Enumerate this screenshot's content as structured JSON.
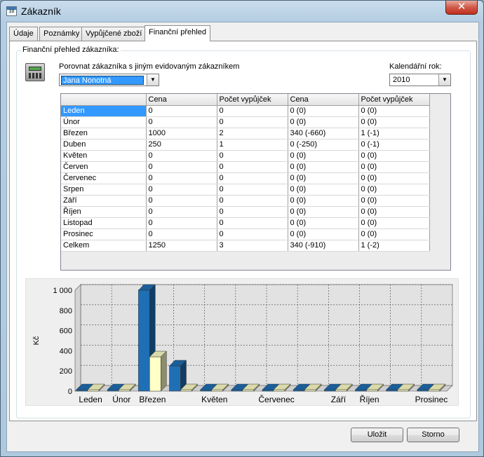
{
  "window": {
    "title": "Zákazník",
    "close_glyph": "✕"
  },
  "tabs": [
    {
      "label": "Údaje",
      "active": false
    },
    {
      "label": "Poznámky",
      "active": false
    },
    {
      "label": "Vypůjčené zboží",
      "active": false
    },
    {
      "label": "Finanční přehled",
      "active": true
    }
  ],
  "panel": {
    "group_title": "Finanční přehled zákazníka:",
    "compare_label": "Porovnat zákazníka s jiným evidovaným zákazníkem",
    "compare_value": "Jana Nonotná",
    "year_label": "Kalendářní rok:",
    "year_value": "2010",
    "icon": "calculator-icon"
  },
  "table": {
    "columns": [
      "",
      "Cena",
      "Počet vypůjček",
      "Cena",
      "Počet vypůjček"
    ],
    "rows": [
      [
        "Leden",
        "0",
        "0",
        "0  (0)",
        "0  (0)"
      ],
      [
        "Únor",
        "0",
        "0",
        "0  (0)",
        "0  (0)"
      ],
      [
        "Březen",
        "1000",
        "2",
        "340  (-660)",
        "1  (-1)"
      ],
      [
        "Duben",
        "250",
        "1",
        "0  (-250)",
        "0  (-1)"
      ],
      [
        "Květen",
        "0",
        "0",
        "0  (0)",
        "0  (0)"
      ],
      [
        "Červen",
        "0",
        "0",
        "0  (0)",
        "0  (0)"
      ],
      [
        "Červenec",
        "0",
        "0",
        "0  (0)",
        "0  (0)"
      ],
      [
        "Srpen",
        "0",
        "0",
        "0  (0)",
        "0  (0)"
      ],
      [
        "Září",
        "0",
        "0",
        "0  (0)",
        "0  (0)"
      ],
      [
        "Říjen",
        "0",
        "0",
        "0  (0)",
        "0  (0)"
      ],
      [
        "Listopad",
        "0",
        "0",
        "0  (0)",
        "0  (0)"
      ],
      [
        "Prosinec",
        "0",
        "0",
        "0  (0)",
        "0  (0)"
      ],
      [
        "Celkem",
        "1250",
        "3",
        "340  (-910)",
        "1  (-2)"
      ]
    ],
    "selected_row": 0
  },
  "chart_data": {
    "type": "bar",
    "categories": [
      "Leden",
      "Únor",
      "Březen",
      "Duben",
      "Květen",
      "Červen",
      "Červenec",
      "Srpen",
      "Září",
      "Říjen",
      "Listopad",
      "Prosinec"
    ],
    "visible_category_labels": [
      "Leden",
      "Únor",
      "Březen",
      "",
      "Květen",
      "",
      "Červenec",
      "",
      "Září",
      "Říjen",
      "",
      "Prosinec"
    ],
    "series": [
      {
        "values": [
          0,
          0,
          1000,
          250,
          0,
          0,
          0,
          0,
          0,
          0,
          0,
          0
        ],
        "color": "#1f6fb5"
      },
      {
        "values": [
          0,
          0,
          340,
          0,
          0,
          0,
          0,
          0,
          0,
          0,
          0,
          0
        ],
        "color": "#ffffc8"
      }
    ],
    "ylabel": "Kč",
    "yticks": [
      "0",
      "200",
      "400",
      "600",
      "800",
      "1 000"
    ],
    "ylim": [
      0,
      1000
    ],
    "grid": true,
    "legend": "none"
  },
  "buttons": {
    "save": "Uložit",
    "cancel": "Storno"
  }
}
